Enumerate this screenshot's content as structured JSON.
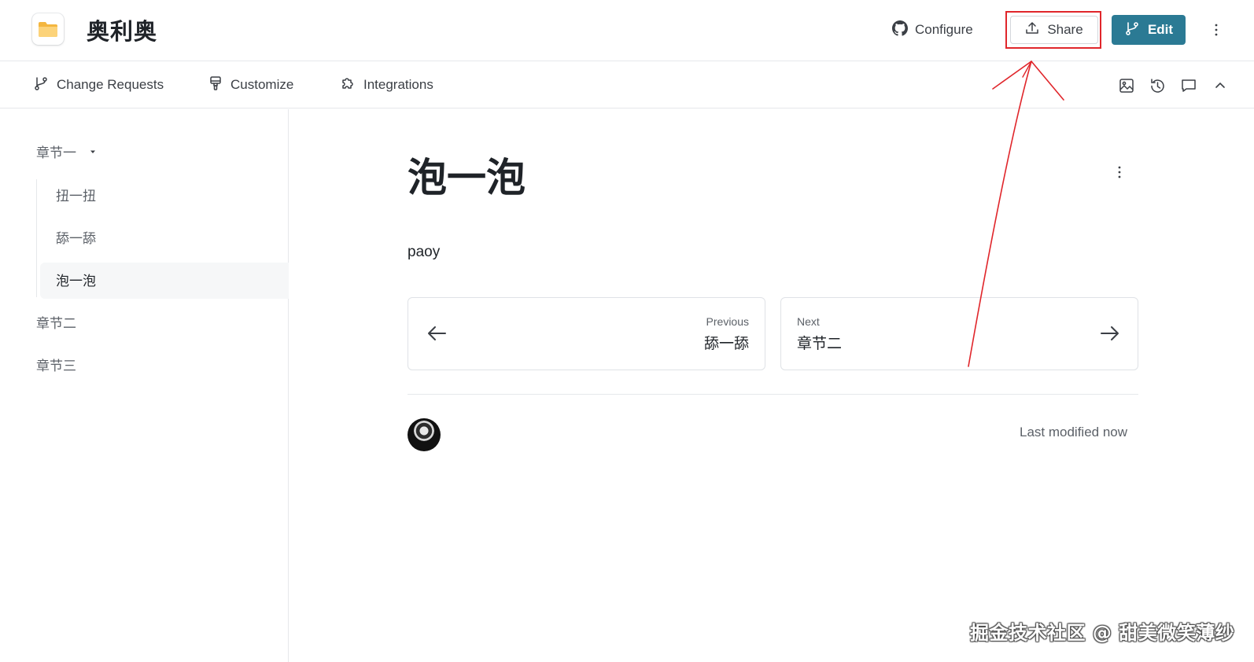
{
  "header": {
    "site_title": "奥利奥",
    "configure_label": "Configure",
    "share_label": "Share",
    "edit_label": "Edit"
  },
  "subnav": {
    "items": [
      {
        "label": "Change Requests",
        "icon": "branch-icon"
      },
      {
        "label": "Customize",
        "icon": "paint-brush-icon"
      },
      {
        "label": "Integrations",
        "icon": "puzzle-icon"
      }
    ],
    "right_icons": [
      "image-icon",
      "history-icon",
      "comment-icon",
      "chevron-up-icon"
    ]
  },
  "sidebar": {
    "items": [
      {
        "label": "章节一",
        "expanded": true
      },
      {
        "label": "扭一扭"
      },
      {
        "label": "舔一舔"
      },
      {
        "label": "泡一泡",
        "active": true
      },
      {
        "label": "章节二"
      },
      {
        "label": "章节三"
      }
    ]
  },
  "page": {
    "title": "泡一泡",
    "body": "paoy",
    "previous": {
      "label": "Previous",
      "title": "舔一舔"
    },
    "next": {
      "label": "Next",
      "title": "章节二"
    },
    "last_modified": "Last modified now"
  },
  "colors": {
    "accent": "#2b7a94",
    "annotation": "#e0262b"
  },
  "watermark": "掘金技术社区 @ 甜美微笑薄纱"
}
